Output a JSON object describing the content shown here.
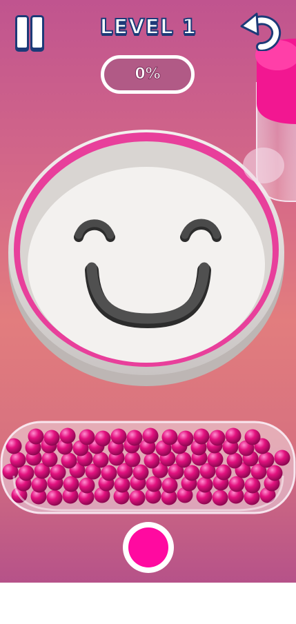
{
  "hud": {
    "level_label": "LEVEL 1",
    "progress_text": "0%",
    "progress_fraction": 0.0
  },
  "icons": {
    "pause": "pause-icon",
    "undo": "undo-icon"
  },
  "colors": {
    "ball": "#e3127f",
    "tray_rim": "#e83f9b",
    "color_button": "#ff0aa0",
    "hud_outline": "#1c3a78"
  }
}
